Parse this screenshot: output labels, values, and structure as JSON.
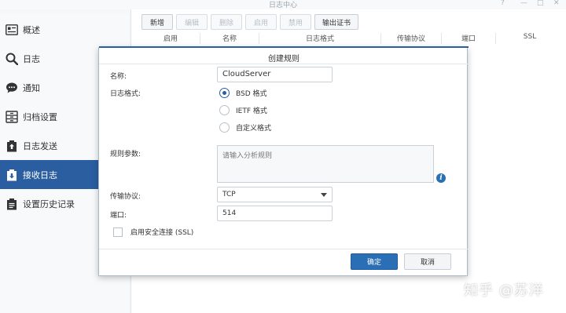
{
  "window": {
    "title": "日志中心",
    "controls": [
      "?",
      "—",
      "□",
      "✕"
    ]
  },
  "sidebar": {
    "items": [
      {
        "label": "概述",
        "icon": "overview-icon"
      },
      {
        "label": "日志",
        "icon": "search-icon"
      },
      {
        "label": "通知",
        "icon": "chat-bubble-icon"
      },
      {
        "label": "归档设置",
        "icon": "archive-icon"
      },
      {
        "label": "日志发送",
        "icon": "upload-doc-icon"
      },
      {
        "label": "接收日志",
        "icon": "download-doc-icon",
        "active": true
      },
      {
        "label": "设置历史记录",
        "icon": "clipboard-icon"
      }
    ]
  },
  "toolbar": {
    "buttons": [
      {
        "label": "新增",
        "enabled": true
      },
      {
        "label": "编辑",
        "enabled": false
      },
      {
        "label": "删除",
        "enabled": false
      },
      {
        "label": "启用",
        "enabled": false
      },
      {
        "label": "禁用",
        "enabled": false
      },
      {
        "label": "输出证书",
        "enabled": true
      }
    ]
  },
  "table": {
    "columns": [
      "启用",
      "名称",
      "日志格式",
      "传输协议",
      "端口",
      "SSL"
    ]
  },
  "dialog": {
    "title": "创建规则",
    "name_label": "名称:",
    "name_value": "CloudServer",
    "format_label": "日志格式:",
    "formats": [
      {
        "label": "BSD 格式",
        "checked": true
      },
      {
        "label": "IETF 格式",
        "checked": false
      },
      {
        "label": "自定义格式",
        "checked": false
      }
    ],
    "rule_params_label": "规则参数:",
    "rule_params_placeholder": "请输入分析规则",
    "protocol_label": "传输协议:",
    "protocol_value": "TCP",
    "port_label": "端口:",
    "port_value": "514",
    "ssl_label": "启用安全连接 (SSL)",
    "ssl_checked": false,
    "confirm_label": "确定",
    "cancel_label": "取消"
  },
  "watermark": "知乎 @苏洋",
  "colors": {
    "accent": "#2a5ea0",
    "primary_button": "#2a6fb5"
  }
}
